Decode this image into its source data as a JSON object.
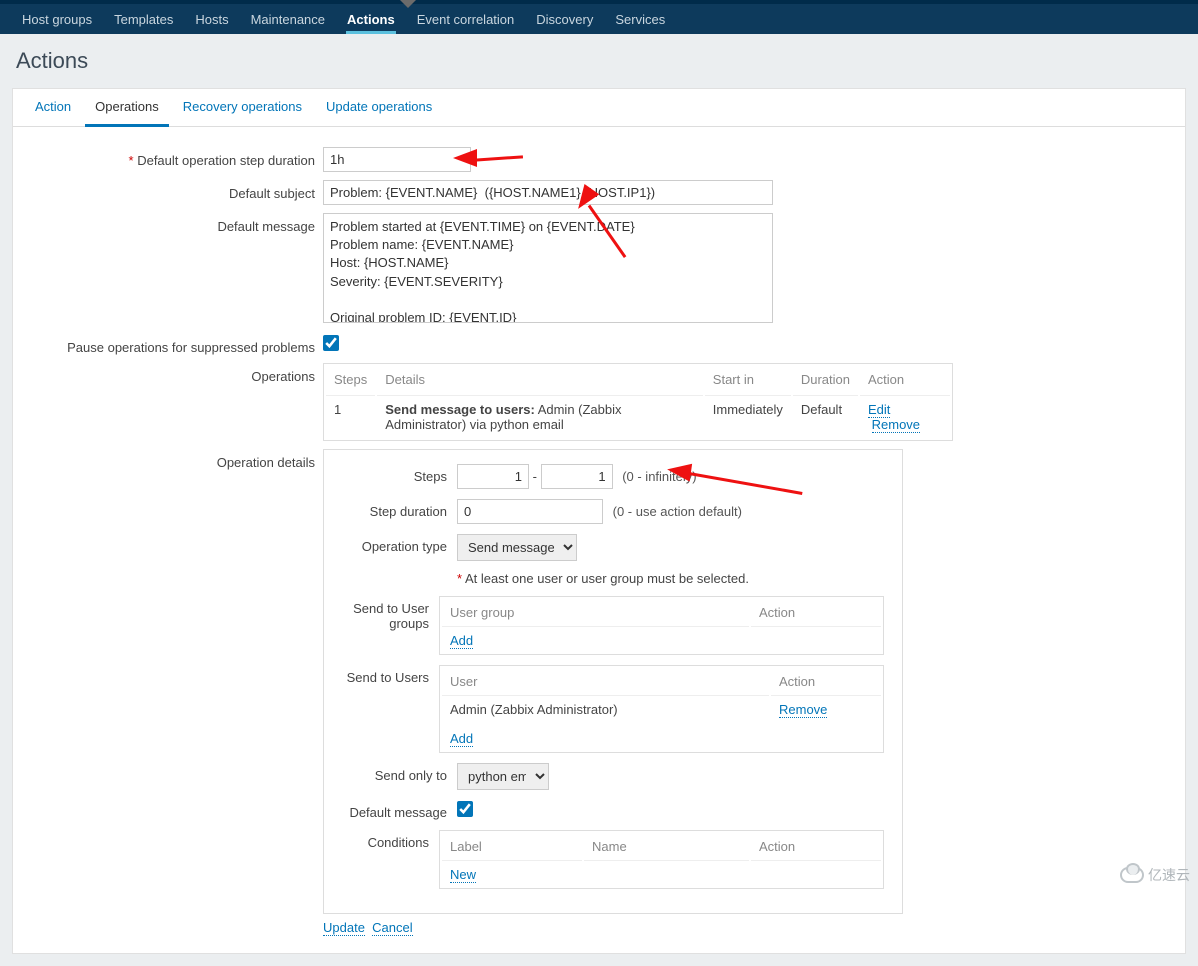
{
  "colors": {
    "navbar": "#0d3a5c",
    "accent": "#0275b8",
    "error": "#cc0000"
  },
  "topnav": {
    "items": [
      {
        "label": "Host groups"
      },
      {
        "label": "Templates"
      },
      {
        "label": "Hosts"
      },
      {
        "label": "Maintenance"
      },
      {
        "label": "Actions"
      },
      {
        "label": "Event correlation"
      },
      {
        "label": "Discovery"
      },
      {
        "label": "Services"
      }
    ],
    "active_index": 4
  },
  "page_title": "Actions",
  "subtabs": {
    "items": [
      {
        "label": "Action"
      },
      {
        "label": "Operations"
      },
      {
        "label": "Recovery operations"
      },
      {
        "label": "Update operations"
      }
    ],
    "active_index": 1
  },
  "form": {
    "duration_label": "Default operation step duration",
    "duration_value": "1h",
    "subject_label": "Default subject",
    "subject_value": "Problem: {EVENT.NAME}  ({HOST.NAME1} {HOST.IP1})",
    "message_label": "Default message",
    "message_value": "Problem started at {EVENT.TIME} on {EVENT.DATE}\nProblem name: {EVENT.NAME}\nHost: {HOST.NAME}\nSeverity: {EVENT.SEVERITY}\n\nOriginal problem ID: {EVENT.ID}\n{TRIGGER.URL}",
    "pause_label": "Pause operations for suppressed problems",
    "pause_checked": true,
    "operations_label": "Operations",
    "op_headers": {
      "steps": "Steps",
      "details": "Details",
      "startin": "Start in",
      "duration": "Duration",
      "action": "Action"
    },
    "op_rows": [
      {
        "steps": "1",
        "details_strong": "Send message to users:",
        "details_rest": " Admin (Zabbix Administrator) via python email",
        "startin": "Immediately",
        "duration": "Default",
        "edit": "Edit",
        "remove": "Remove"
      }
    ],
    "opdetails_label": "Operation details"
  },
  "details": {
    "steps_label": "Steps",
    "steps_from": "1",
    "steps_to": "1",
    "steps_hint": "(0 - infinitely)",
    "dur_label": "Step duration",
    "dur_value": "0",
    "dur_hint": "(0 - use action default)",
    "optype_label": "Operation type",
    "optype_value": "Send message",
    "require_msg": "At least one user or user group must be selected.",
    "sendgroups_label": "Send to User groups",
    "groups_head_user": "User group",
    "groups_head_action": "Action",
    "groups_add": "Add",
    "sendusers_label": "Send to Users",
    "users_head_user": "User",
    "users_head_action": "Action",
    "users_rows": [
      {
        "user": "Admin (Zabbix Administrator)",
        "remove": "Remove"
      }
    ],
    "users_add": "Add",
    "sendonly_label": "Send only to",
    "sendonly_value": "python email",
    "defmsg_label": "Default message",
    "defmsg_checked": true,
    "cond_label": "Conditions",
    "cond_head_label": "Label",
    "cond_head_name": "Name",
    "cond_head_action": "Action",
    "cond_new": "New",
    "update": "Update",
    "cancel": "Cancel"
  },
  "watermark": "亿速云"
}
